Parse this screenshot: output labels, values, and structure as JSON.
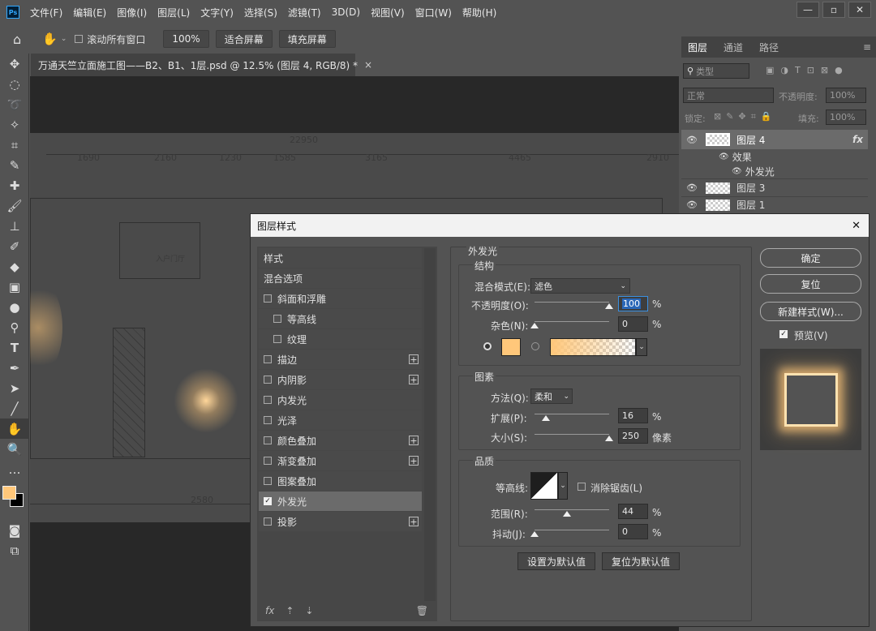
{
  "menubar": {
    "logo": "Ps",
    "items": [
      "文件(F)",
      "编辑(E)",
      "图像(I)",
      "图层(L)",
      "文字(Y)",
      "选择(S)",
      "滤镜(T)",
      "3D(D)",
      "视图(V)",
      "窗口(W)",
      "帮助(H)"
    ],
    "window_controls": [
      "—",
      "▫",
      "✕"
    ]
  },
  "options": {
    "scroll_all_label": "滚动所有窗口",
    "zoom_value": "100%",
    "fit_screen": "适合屏幕",
    "fill_screen": "填充屏幕"
  },
  "document": {
    "tab_title": "万通天竺立面施工图——B2、B1、1层.psd @ 12.5% (图层 4, RGB/8) *",
    "close": "×"
  },
  "drawing": {
    "total": "22950",
    "top_dims": [
      "1690",
      "2160",
      "1230",
      "1585",
      "3165",
      "4465",
      "2910"
    ],
    "bottom_dims": [
      "2580"
    ],
    "room_label": "入户门厅"
  },
  "colors": {
    "foreground": "#ffc77a",
    "background": "#000000",
    "glow": "#ffc77a"
  },
  "layers_panel": {
    "tabs": [
      "图层",
      "通道",
      "路径"
    ],
    "kind_label": "类型",
    "blend_mode": "正常",
    "opacity_label": "不透明度:",
    "opacity_value": "100%",
    "lock_label": "锁定:",
    "fill_label": "填充:",
    "fill_value": "100%",
    "layers": [
      {
        "name": "图层 4",
        "fx": "fx",
        "active": true
      },
      {
        "name": "效果",
        "sub": true
      },
      {
        "name": "外发光",
        "sub": true
      },
      {
        "name": "图层 3"
      },
      {
        "name": "图层 1"
      }
    ]
  },
  "dialog": {
    "title": "图层样式",
    "close": "✕",
    "styles_header": "样式",
    "blend_options": "混合选项",
    "style_list": [
      {
        "label": "斜面和浮雕",
        "checked": false,
        "plus": false,
        "indent": false
      },
      {
        "label": "等高线",
        "checked": false,
        "plus": false,
        "indent": true
      },
      {
        "label": "纹理",
        "checked": false,
        "plus": false,
        "indent": true
      },
      {
        "label": "描边",
        "checked": false,
        "plus": true,
        "indent": false
      },
      {
        "label": "内阴影",
        "checked": false,
        "plus": true,
        "indent": false
      },
      {
        "label": "内发光",
        "checked": false,
        "plus": false,
        "indent": false
      },
      {
        "label": "光泽",
        "checked": false,
        "plus": false,
        "indent": false
      },
      {
        "label": "颜色叠加",
        "checked": false,
        "plus": true,
        "indent": false
      },
      {
        "label": "渐变叠加",
        "checked": false,
        "plus": true,
        "indent": false
      },
      {
        "label": "图案叠加",
        "checked": false,
        "plus": false,
        "indent": false
      },
      {
        "label": "外发光",
        "checked": true,
        "plus": false,
        "indent": false
      },
      {
        "label": "投影",
        "checked": false,
        "plus": true,
        "indent": false
      }
    ],
    "section_title": "外发光",
    "structure": {
      "title": "结构",
      "blend_label": "混合模式(E):",
      "blend_value": "滤色",
      "opacity_label": "不透明度(O):",
      "opacity_value": "100",
      "opacity_unit": "%",
      "noise_label": "杂色(N):",
      "noise_value": "0",
      "noise_unit": "%"
    },
    "elements": {
      "title": "图素",
      "method_label": "方法(Q):",
      "method_value": "柔和",
      "spread_label": "扩展(P):",
      "spread_value": "16",
      "spread_unit": "%",
      "size_label": "大小(S):",
      "size_value": "250",
      "size_unit": "像素"
    },
    "quality": {
      "title": "品质",
      "contour_label": "等高线:",
      "antialias_label": "消除锯齿(L)",
      "range_label": "范围(R):",
      "range_value": "44",
      "range_unit": "%",
      "jitter_label": "抖动(J):",
      "jitter_value": "0",
      "jitter_unit": "%"
    },
    "set_default": "设置为默认值",
    "reset_default": "复位为默认值",
    "ok": "确定",
    "reset": "复位",
    "new_style": "新建样式(W)...",
    "preview": "预览(V)",
    "slider_levels": {
      "opacity": 1.0,
      "noise": 0.0,
      "spread": 0.16,
      "size": 1.0,
      "range": 0.44,
      "jitter": 0.0
    }
  }
}
